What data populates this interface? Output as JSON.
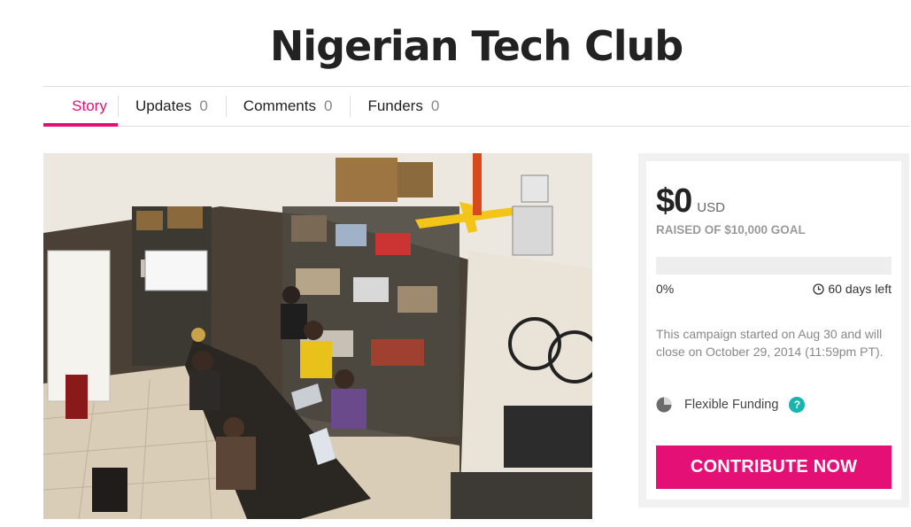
{
  "campaign": {
    "title": "Nigerian Tech Club"
  },
  "tabs": [
    {
      "label": "Story",
      "count": null
    },
    {
      "label": "Updates",
      "count": "0"
    },
    {
      "label": "Comments",
      "count": "0"
    },
    {
      "label": "Funders",
      "count": "0"
    }
  ],
  "funding": {
    "amount": "$0",
    "currency": "USD",
    "goal_text": "RAISED OF $10,000 GOAL",
    "progress_fraction": 0,
    "percent_label": "0%",
    "days_left": "60 days left",
    "description": "This campaign started on Aug 30 and will close on October 29, 2014 (11:59pm PT).",
    "funding_type": "Flexible Funding",
    "help_symbol": "?",
    "cta_label": "CONTRIBUTE NOW"
  },
  "icons": {
    "clock": "clock-icon",
    "pie": "pie-chart-icon",
    "help": "help-icon"
  },
  "colors": {
    "accent": "#e51075",
    "help": "#17b5b0"
  }
}
